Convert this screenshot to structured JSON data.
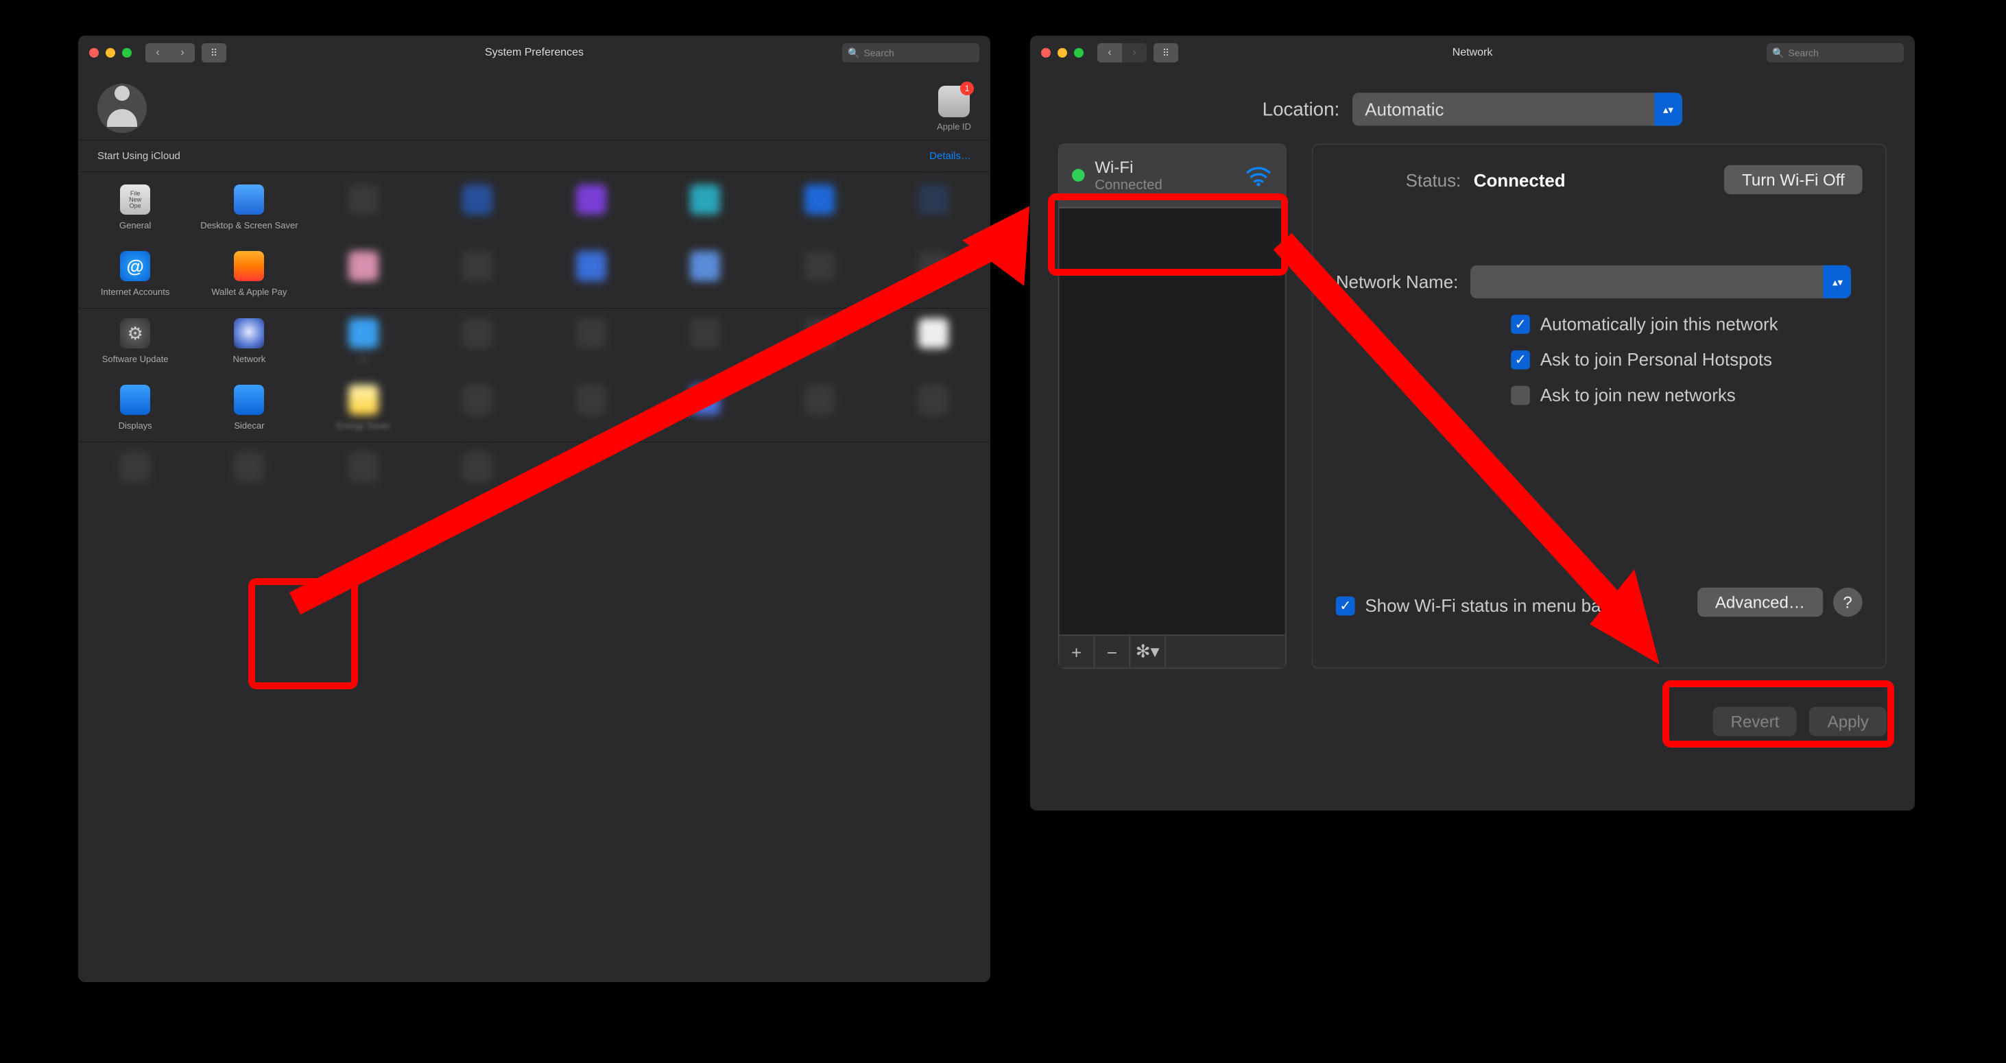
{
  "sysprefs": {
    "title": "System Preferences",
    "search_placeholder": "Search",
    "apple_id_label": "Apple ID",
    "apple_id_badge": "1",
    "banner_text": "Start Using iCloud",
    "banner_link": "Details…",
    "items": {
      "general": "General",
      "desktop": "Desktop & Screen Saver",
      "internet_accounts": "Internet Accounts",
      "wallet": "Wallet & Apple Pay",
      "software_update": "Software Update",
      "network": "Network",
      "displays": "Displays",
      "sidecar": "Sidecar",
      "energy": "Energy Saver"
    }
  },
  "network": {
    "title": "Network",
    "search_placeholder": "Search",
    "location_label": "Location:",
    "location_value": "Automatic",
    "service": {
      "name": "Wi-Fi",
      "status": "Connected"
    },
    "status_label": "Status:",
    "status_value": "Connected",
    "turn_off": "Turn Wi-Fi Off",
    "network_name_label": "Network Name:",
    "chk_auto_join": "Automatically join this network",
    "chk_hotspots": "Ask to join Personal Hotspots",
    "chk_new_networks": "Ask to join new networks",
    "menubar": "Show Wi-Fi status in menu bar",
    "advanced": "Advanced…",
    "revert": "Revert",
    "apply": "Apply",
    "assist": "?"
  }
}
